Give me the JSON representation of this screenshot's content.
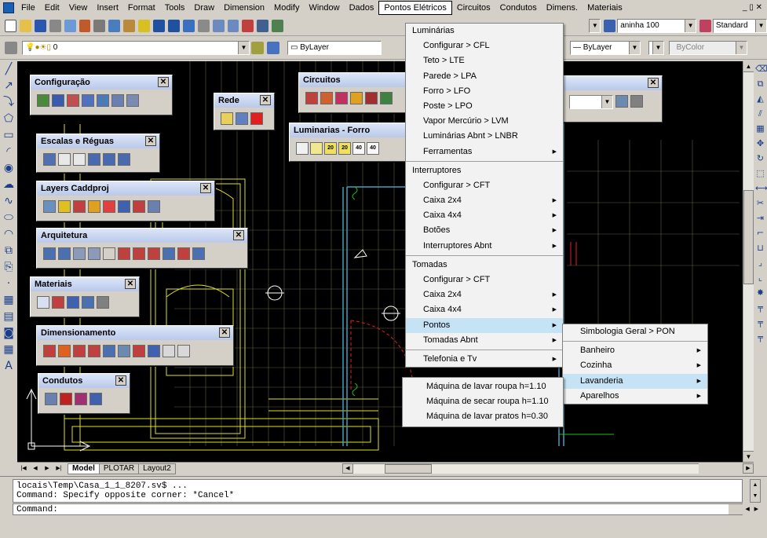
{
  "menubar": {
    "items": [
      "File",
      "Edit",
      "View",
      "Insert",
      "Format",
      "Tools",
      "Draw",
      "Dimension",
      "Modify",
      "Window",
      "Dados",
      "Pontos Elétricos",
      "Circuitos",
      "Condutos",
      "Dimens.",
      "Materiais"
    ],
    "window_controls": "_ ▯ ✕"
  },
  "toolbar": {
    "textstyle_value": "aninha 100",
    "dimstyle_value": "Standard",
    "layer_value": "0",
    "color_value": "ByLayer",
    "linetype_value": "ByLayer",
    "lineweight_value": "ByLayer",
    "plotstyle_value": "ByColor"
  },
  "palettes": {
    "configuracao": "Configuração",
    "rede": "Rede",
    "circuitos": "Circuitos",
    "luminarias_forro": "Luminarias - Forro",
    "escalas": "Escalas e Réguas",
    "layers": "Layers Caddproj",
    "arquitetura": "Arquitetura",
    "materiais": "Materiais",
    "dimensionamento": "Dimensionamento",
    "condutos": "Condutos",
    "luminarias_icons": [
      "20",
      "20",
      "40",
      "40"
    ]
  },
  "pontos_menu": {
    "items": [
      {
        "label": "Luminárias",
        "type": "header"
      },
      {
        "label": "Configurar > CFL",
        "type": "item"
      },
      {
        "label": "Teto > LTE",
        "type": "item"
      },
      {
        "label": "Parede > LPA",
        "type": "item"
      },
      {
        "label": "Forro > LFO",
        "type": "item"
      },
      {
        "label": "Poste > LPO",
        "type": "item"
      },
      {
        "label": "Vapor Mercúrio > LVM",
        "type": "item"
      },
      {
        "label": "Luminárias Abnt > LNBR",
        "type": "item"
      },
      {
        "label": "Ferramentas",
        "type": "sub"
      },
      {
        "type": "sep"
      },
      {
        "label": "Interruptores",
        "type": "header"
      },
      {
        "label": "Configurar > CFT",
        "type": "item"
      },
      {
        "label": "Caixa 2x4",
        "type": "sub"
      },
      {
        "label": "Caixa 4x4",
        "type": "sub"
      },
      {
        "label": "Botões",
        "type": "sub"
      },
      {
        "label": "Interruptores Abnt",
        "type": "sub"
      },
      {
        "type": "sep"
      },
      {
        "label": "Tomadas",
        "type": "header"
      },
      {
        "label": "Configurar > CFT",
        "type": "item"
      },
      {
        "label": "Caixa 2x4",
        "type": "sub"
      },
      {
        "label": "Caixa 4x4",
        "type": "sub"
      },
      {
        "label": "Pontos",
        "type": "sub",
        "highlight": true
      },
      {
        "label": "Tomadas Abnt",
        "type": "sub"
      },
      {
        "type": "sep"
      },
      {
        "label": "Telefonia e Tv",
        "type": "sub"
      }
    ]
  },
  "pontos_submenu": {
    "items": [
      {
        "label": "Simbologia Geral > PON",
        "type": "item"
      },
      {
        "type": "sep"
      },
      {
        "label": "Banheiro",
        "type": "sub"
      },
      {
        "label": "Cozinha",
        "type": "sub"
      },
      {
        "label": "Lavanderia",
        "type": "sub",
        "highlight": true
      },
      {
        "label": "Aparelhos",
        "type": "sub"
      }
    ]
  },
  "lavanderia_submenu": {
    "items": [
      "Máquina de lavar roupa h=1.10",
      "Máquina de secar roupa h=1.10",
      "Máquina de lavar pratos h=0.30"
    ]
  },
  "layout_tabs": [
    "Model",
    "PLOTAR",
    "Layout2"
  ],
  "command": {
    "history": [
      "locais\\Temp\\Casa_1_1_8207.sv$ ...",
      "Command: Specify opposite corner: *Cancel*"
    ],
    "prompt": "Command:"
  }
}
